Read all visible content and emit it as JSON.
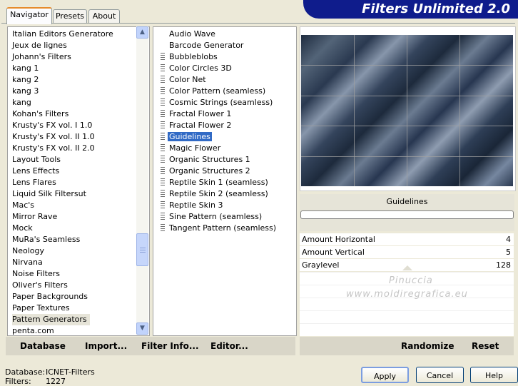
{
  "tabs": [
    "Navigator",
    "Presets",
    "About"
  ],
  "app_title": "Filters Unlimited 2.0",
  "categories": [
    "Italian Editors Generatore",
    "Jeux de lignes",
    "Johann's Filters",
    "kang 1",
    "kang 2",
    "kang 3",
    "kang",
    "Kohan's Filters",
    "Krusty's FX vol. I 1.0",
    "Krusty's FX vol. II 1.0",
    "Krusty's FX vol. II 2.0",
    "Layout Tools",
    "Lens Effects",
    "Lens Flares",
    "Liquid Silk Filtersut",
    "Mac's",
    "Mirror Rave",
    "Mock",
    "MuRa's Seamless",
    "Neology",
    "Nirvana",
    "Noise Filters",
    "Oliver's Filters",
    "Paper Backgrounds",
    "Paper Textures",
    "Pattern Generators",
    "penta.com"
  ],
  "selected_category": "Pattern Generators",
  "filters": [
    {
      "label": "Audio Wave",
      "icon": false
    },
    {
      "label": "Barcode Generator",
      "icon": false
    },
    {
      "label": "Bubbleblobs",
      "icon": true
    },
    {
      "label": "Color Circles 3D",
      "icon": true
    },
    {
      "label": "Color Net",
      "icon": true
    },
    {
      "label": "Color Pattern (seamless)",
      "icon": true
    },
    {
      "label": "Cosmic Strings (seamless)",
      "icon": true
    },
    {
      "label": "Fractal Flower 1",
      "icon": true
    },
    {
      "label": "Fractal Flower 2",
      "icon": true
    },
    {
      "label": "Guidelines",
      "icon": true
    },
    {
      "label": "Magic Flower",
      "icon": true
    },
    {
      "label": "Organic Structures 1",
      "icon": true
    },
    {
      "label": "Organic Structures 2",
      "icon": true
    },
    {
      "label": "Reptile Skin 1 (seamless)",
      "icon": true
    },
    {
      "label": "Reptile Skin 2 (seamless)",
      "icon": true
    },
    {
      "label": "Reptile Skin 3",
      "icon": true
    },
    {
      "label": "Sine Pattern (seamless)",
      "icon": true
    },
    {
      "label": "Tangent Pattern (seamless)",
      "icon": true
    }
  ],
  "selected_filter": "Guidelines",
  "filter_name_display": "Guidelines",
  "params": [
    {
      "label": "Amount Horizontal",
      "value": "4"
    },
    {
      "label": "Amount Vertical",
      "value": "5"
    },
    {
      "label": "Graylevel",
      "value": "128"
    }
  ],
  "watermark": {
    "line1": "Pinuccia",
    "line2": "www.moldiregrafica.eu"
  },
  "bottom_left_buttons": [
    "Database",
    "Import...",
    "Filter Info...",
    "Editor..."
  ],
  "bottom_right_buttons": [
    "Randomize",
    "Reset"
  ],
  "info": {
    "database_label": "Database:",
    "database_value": "ICNET-Filters",
    "filters_label": "Filters:",
    "filters_value": "1227"
  },
  "dialog_buttons": [
    "Apply",
    "Cancel",
    "Help"
  ],
  "colors": {
    "selection": "#316ac5",
    "banner": "#0f1c8c",
    "background": "#ece9d8"
  }
}
